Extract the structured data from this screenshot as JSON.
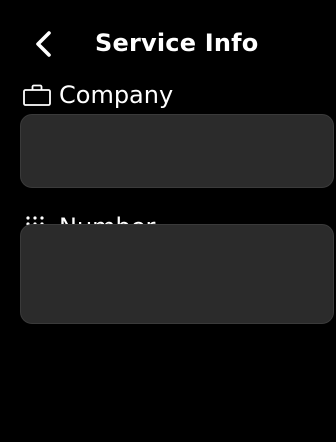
{
  "header": {
    "title": "Service Info",
    "back_icon": "chevron-left-icon"
  },
  "fields": [
    {
      "label": "Company",
      "icon": "briefcase-icon",
      "value": ""
    },
    {
      "label": "Number",
      "icon": "dialpad-icon",
      "value": ""
    }
  ],
  "colors": {
    "background": "#000000",
    "text": "#ffffff",
    "field_background": "#2b2b2b",
    "field_border": "#3a3a3a"
  }
}
